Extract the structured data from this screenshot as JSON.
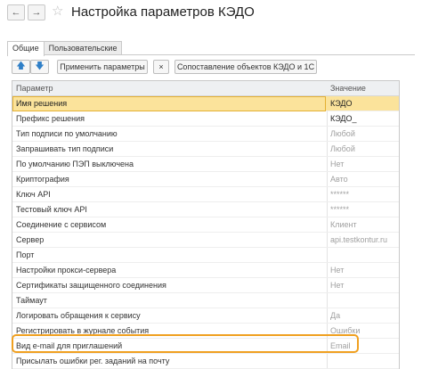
{
  "window": {
    "title": "Настройка параметров КЭДО"
  },
  "nav": {
    "back": "←",
    "forward": "→",
    "favorite": "☆"
  },
  "tabs": [
    {
      "label": "Общие"
    },
    {
      "label": "Пользовательские"
    }
  ],
  "toolbar": {
    "up": "🡅",
    "down": "🡇",
    "apply_label": "Применить параметры",
    "clear_label": "×",
    "match_label": "Сопоставление объектов КЭДО и 1С"
  },
  "table": {
    "headers": {
      "param": "Параметр",
      "value": "Значение"
    },
    "rows": [
      {
        "param": "Имя решения",
        "value": "КЭДО"
      },
      {
        "param": "Префикс решения",
        "value": "КЭДО_"
      },
      {
        "param": "Тип подписи по умолчанию",
        "value": "Любой"
      },
      {
        "param": "Запрашивать тип подписи",
        "value": "Любой"
      },
      {
        "param": "По умолчанию ПЭП выключена",
        "value": "Нет"
      },
      {
        "param": "Криптография",
        "value": "Авто"
      },
      {
        "param": "Ключ API",
        "value": "******"
      },
      {
        "param": "Тестовый ключ API",
        "value": "******"
      },
      {
        "param": "Соединение с сервисом",
        "value": "Клиент"
      },
      {
        "param": "Сервер",
        "value": "api.testkontur.ru"
      },
      {
        "param": "Порт",
        "value": ""
      },
      {
        "param": "Настройки прокси-сервера",
        "value": "Нет"
      },
      {
        "param": "Сертификаты защищенного соединения",
        "value": "Нет"
      },
      {
        "param": "Таймаут",
        "value": ""
      },
      {
        "param": "Логировать обращения к сервису",
        "value": "Да"
      },
      {
        "param": "Регистрировать в журнале события",
        "value": "Ошибки"
      },
      {
        "param": "Вид e-mail для приглашений",
        "value": "Email"
      },
      {
        "param": "Присылать ошибки рег. заданий на почту",
        "value": ""
      }
    ]
  },
  "colors": {
    "selection": "#fbe39b",
    "highlight": "#f0a020",
    "accent": "#2f7fc7"
  }
}
